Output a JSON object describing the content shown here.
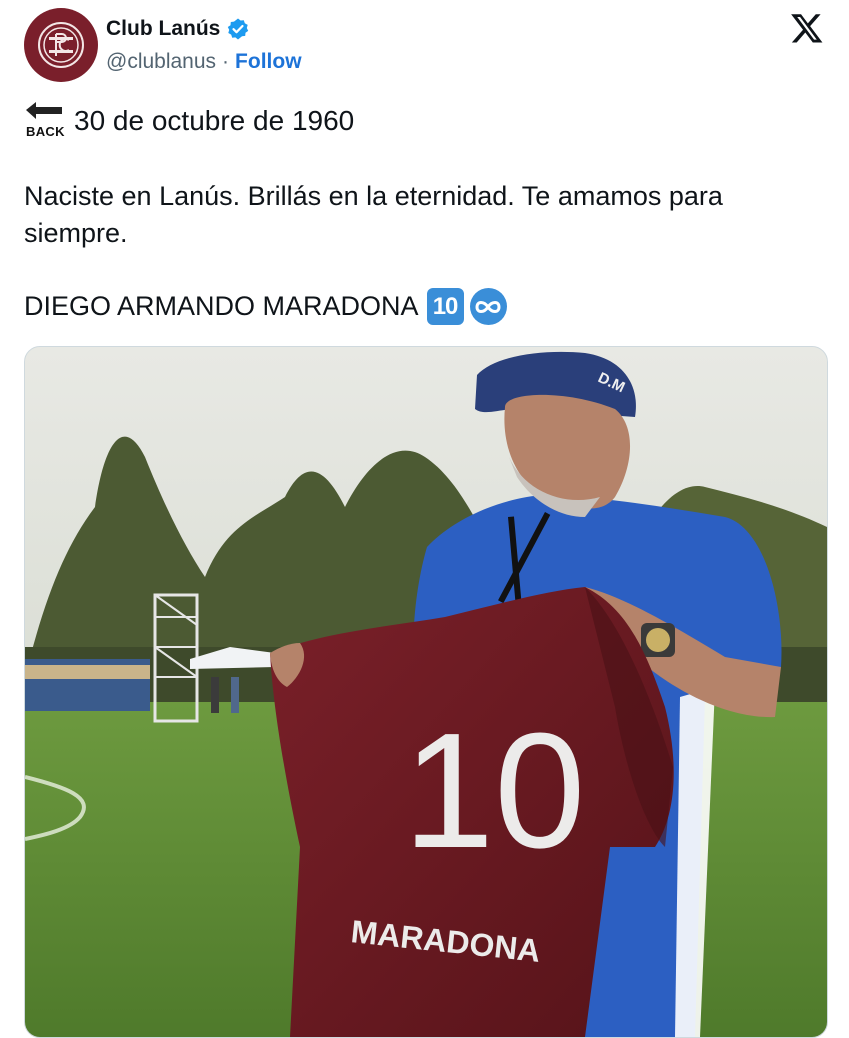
{
  "account": {
    "name": "Club Lanús",
    "handle": "@clublanus",
    "separator": "·",
    "follow_label": "Follow",
    "verified_color": "#1d9bf0"
  },
  "icons": {
    "avatar": "club-lanus-crest-icon",
    "verified": "verified-badge-icon",
    "platform": "x-logo-icon",
    "back": "back-arrow-emoji-icon",
    "keycap": "keycap-10-emoji-icon",
    "infinity": "infinity-emoji-icon"
  },
  "tweet": {
    "back_emoji_label": "BACK",
    "date_line": "30 de octubre de 1960",
    "paragraph1": "Naciste en Lanús. Brillás en la eternidad. Te amamos para siempre.",
    "paragraph2": "DIEGO ARMANDO MARADONA",
    "keycap_label": "10"
  },
  "media": {
    "jersey_number": "10",
    "jersey_name": "MARADONA",
    "cap_initials": "D.M",
    "colors": {
      "jersey": "#6b1a22",
      "shirt": "#2c5fc2",
      "cap": "#2a3f7a",
      "grass": "#5d8a35",
      "sky": "#e6e7e2"
    }
  }
}
